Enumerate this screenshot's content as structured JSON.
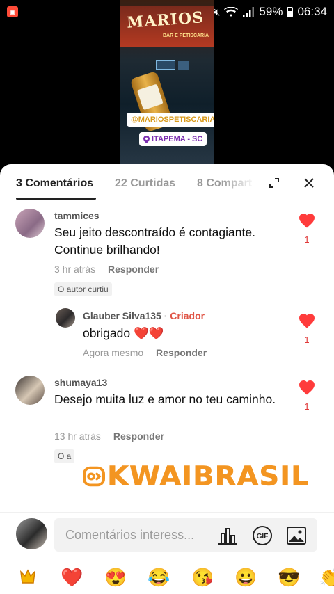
{
  "status_bar": {
    "battery": "59%",
    "time": "06:34"
  },
  "video": {
    "sign_text": "MARIOS",
    "sign_sub": "BAR E PETISCARIA",
    "handle_tag": "@MARIOSPETISCARIA",
    "location_tag": "ITAPEMA - SC"
  },
  "tabs": [
    {
      "label": "3 Comentários"
    },
    {
      "label": "22 Curtidas"
    },
    {
      "label": "8 Compart"
    }
  ],
  "comments": [
    {
      "username": "tammices",
      "text": "Seu jeito descontraído é contagiante. Continue  brilhando!",
      "time": "3 hr atrás",
      "reply_label": "Responder",
      "liked_chip": "O autor curtiu",
      "likes": "1",
      "replies": [
        {
          "username": "Glauber Silva135",
          "creator_badge": "Criador",
          "text": "obrigado ❤️❤️",
          "time": "Agora mesmo",
          "reply_label": "Responder",
          "likes": "1"
        }
      ]
    },
    {
      "username": "shumaya13",
      "text": "Desejo muita luz e amor no teu caminho.",
      "time": "13 hr atrás",
      "reply_label": "Responder",
      "liked_chip": "O a",
      "likes": "1"
    }
  ],
  "watermark": "KWAIBRASIL",
  "input": {
    "placeholder": "Comentários interess..."
  },
  "emojis": [
    "kwai-logo-sticker",
    "❤️",
    "😍",
    "😂",
    "😘",
    "😀",
    "😎",
    "👏"
  ],
  "colors": {
    "accent": "#ff3b3b",
    "creator": "#e05546",
    "watermark": "#f39521"
  }
}
